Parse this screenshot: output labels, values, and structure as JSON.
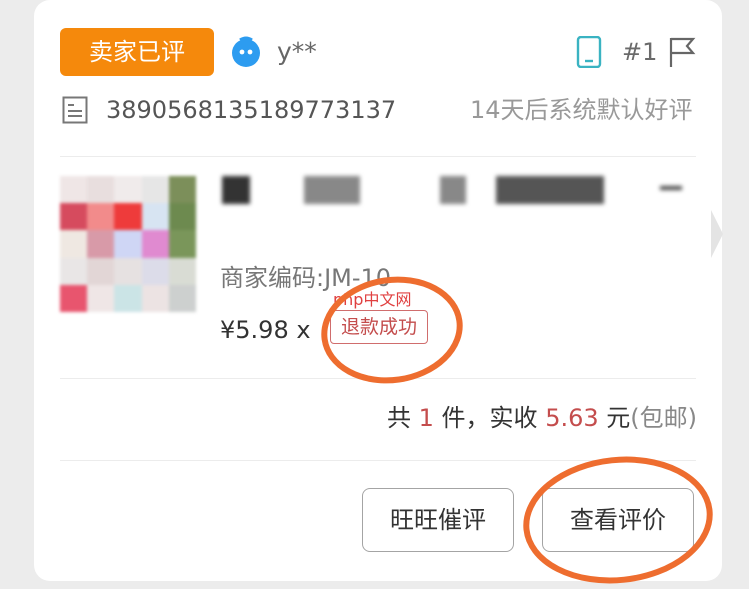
{
  "order": {
    "status_label": "卖家已评",
    "buyer_name": "y**",
    "order_index": "#1",
    "order_number": "3890568135189773137",
    "auto_review_note": "14天后系统默认好评"
  },
  "item": {
    "merchant_code": "商家编码:JM-10",
    "price": "¥5.98 x",
    "refund_status": "退款成功"
  },
  "summary": {
    "prefix": "共",
    "count": "1",
    "unit": "件，实收",
    "amount": "5.63",
    "currency": "元",
    "shipping": "(包邮)"
  },
  "actions": {
    "urge_review": "旺旺催评",
    "view_review": "查看评价"
  },
  "watermark": "php中文网",
  "colors": {
    "status_orange": "#f5890c",
    "accent_red": "#c44d4d",
    "annotation_orange": "#ee6d2f",
    "avatar_blue": "#2d9cf0",
    "phone_teal": "#3ab3c2"
  }
}
